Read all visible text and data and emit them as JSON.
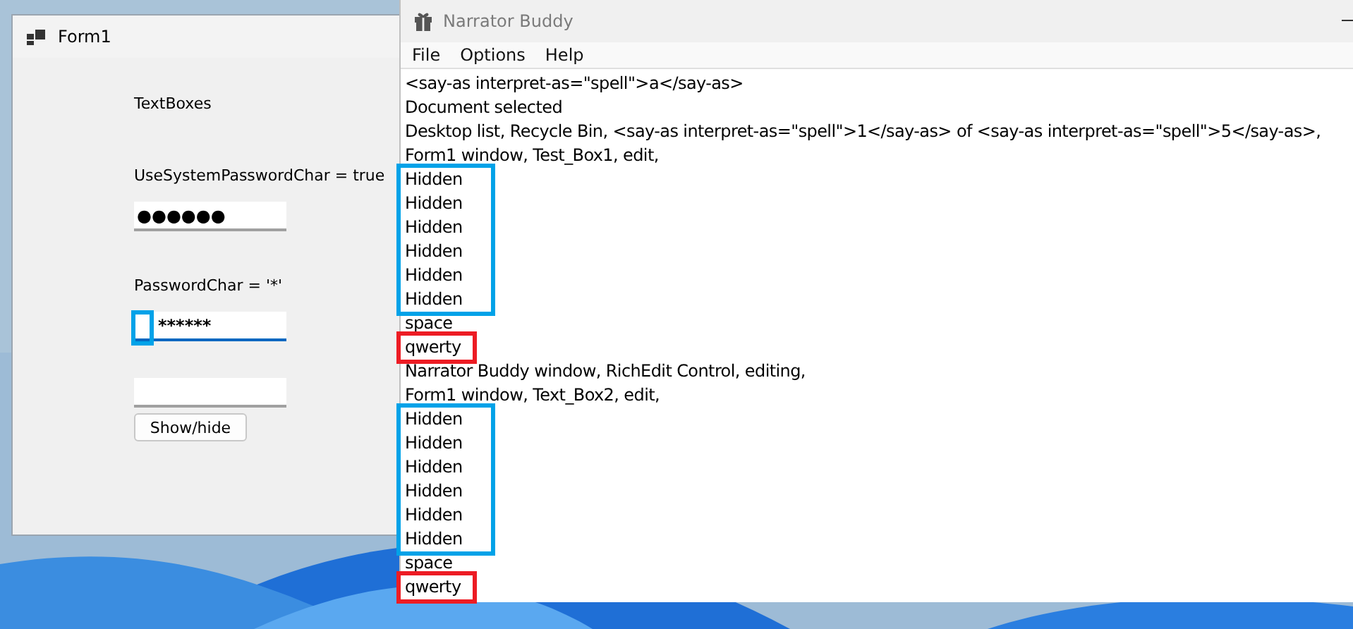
{
  "form_window": {
    "title": "Form1",
    "items": [
      {
        "kind": "label",
        "text": "TextBoxes"
      },
      {
        "kind": "label",
        "text": "UseSystemPasswordChar = true"
      },
      {
        "kind": "field",
        "value": "●●●●●●",
        "focused": false,
        "marked": false
      },
      {
        "kind": "label",
        "text": "PasswordChar = '*'"
      },
      {
        "kind": "field",
        "value": "******",
        "focused": true,
        "marked": true
      },
      {
        "kind": "field",
        "value": "",
        "focused": false,
        "marked": false
      },
      {
        "kind": "button",
        "text": "Show/hide"
      }
    ]
  },
  "narrator_window": {
    "title": "Narrator Buddy",
    "menu": [
      "File",
      "Options",
      "Help"
    ],
    "log": [
      {
        "kind": "line",
        "text": "<say-as interpret-as=\"spell\">a</say-as>"
      },
      {
        "kind": "line",
        "text": "Document selected"
      },
      {
        "kind": "line",
        "text": "Desktop list, Recycle Bin, <say-as interpret-as=\"spell\">1</say-as> of <say-as interpret-as=\"spell\">5</say-as>,"
      },
      {
        "kind": "line",
        "text": "Form1 window, Test_Box1, edit,"
      },
      {
        "kind": "group",
        "color": "#00a2e8",
        "lines": [
          "Hidden",
          "Hidden",
          "Hidden",
          "Hidden",
          "Hidden",
          "Hidden"
        ]
      },
      {
        "kind": "line",
        "text": "space"
      },
      {
        "kind": "group",
        "color": "#ed1c24",
        "lines": [
          "qwerty"
        ]
      },
      {
        "kind": "line",
        "text": "Narrator Buddy window, RichEdit Control, editing,"
      },
      {
        "kind": "line",
        "text": "Form1 window, Text_Box2, edit,"
      },
      {
        "kind": "group",
        "color": "#00a2e8",
        "lines": [
          "Hidden",
          "Hidden",
          "Hidden",
          "Hidden",
          "Hidden",
          "Hidden"
        ]
      },
      {
        "kind": "line",
        "text": "space"
      },
      {
        "kind": "group",
        "color": "#ed1c24",
        "lines": [
          "qwerty"
        ]
      }
    ]
  }
}
